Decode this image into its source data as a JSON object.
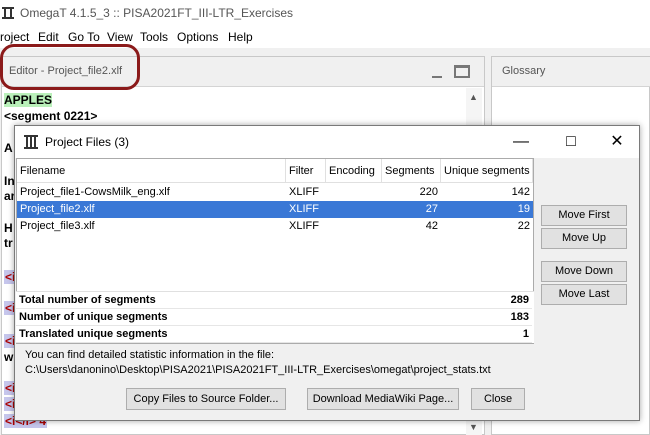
{
  "window": {
    "title": "OmegaT 4.1.5_3 :: PISA2021FT_III-LTR_Exercises"
  },
  "menu": [
    "roject",
    "Edit",
    "Go To",
    "View",
    "Tools",
    "Options",
    "Help"
  ],
  "editor": {
    "header": "Editor - Project_file2.xlf",
    "lines": [
      {
        "text": "APPLES",
        "style": "apples"
      },
      {
        "text": "<segment 0221>",
        "style": "plain"
      },
      {
        "text": "A",
        "style": "plain"
      },
      {
        "text": "In",
        "style": "plain"
      },
      {
        "text": "ar",
        "style": "plain"
      },
      {
        "text": "H",
        "style": "plain"
      },
      {
        "text": "tr",
        "style": "plain"
      },
      {
        "text": "<i",
        "style": "tag"
      },
      {
        "text": "<i",
        "style": "tag"
      },
      {
        "text": "<i",
        "style": "tag"
      },
      {
        "text": "w",
        "style": "plain"
      },
      {
        "text": "<i",
        "style": "tag"
      },
      {
        "text": "<i",
        "style": "tag"
      },
      {
        "text": "<i</i> 4",
        "style": "tag"
      }
    ]
  },
  "glossary": {
    "header": "Glossary"
  },
  "dialog": {
    "title": "Project Files (3)",
    "columns": [
      "Filename",
      "Filter",
      "Encoding",
      "Segments",
      "Unique segments"
    ],
    "rows": [
      {
        "filename": "Project_file1-CowsMilk_eng.xlf",
        "filter": "XLIFF",
        "encoding": "",
        "segments": "220",
        "unique": "142",
        "selected": false
      },
      {
        "filename": "Project_file2.xlf",
        "filter": "XLIFF",
        "encoding": "",
        "segments": "27",
        "unique": "19",
        "selected": true
      },
      {
        "filename": "Project_file3.xlf",
        "filter": "XLIFF",
        "encoding": "",
        "segments": "42",
        "unique": "22",
        "selected": false
      }
    ],
    "totals": [
      {
        "label": "Total number of segments",
        "value": "289"
      },
      {
        "label": "Number of unique segments",
        "value": "183"
      },
      {
        "label": "Translated unique segments",
        "value": "1"
      }
    ],
    "side_buttons": {
      "move_first": "Move First",
      "move_up": "Move Up",
      "move_down": "Move Down",
      "move_last": "Move Last"
    },
    "info_line1": "You can find detailed statistic information in the file:",
    "info_line2": "C:\\Users\\danonino\\Desktop\\PISA2021\\PISA2021FT_III-LTR_Exercises\\omegat\\project_stats.txt",
    "bottom_buttons": {
      "copy": "Copy Files to Source Folder...",
      "download": "Download MediaWiki Page...",
      "close": "Close"
    }
  },
  "colors": {
    "selection": "#3a78d6",
    "highlight_circle": "#8b1a1a",
    "apples_bg": "#b9f0b9",
    "tag_bg": "#c6c6ec"
  }
}
